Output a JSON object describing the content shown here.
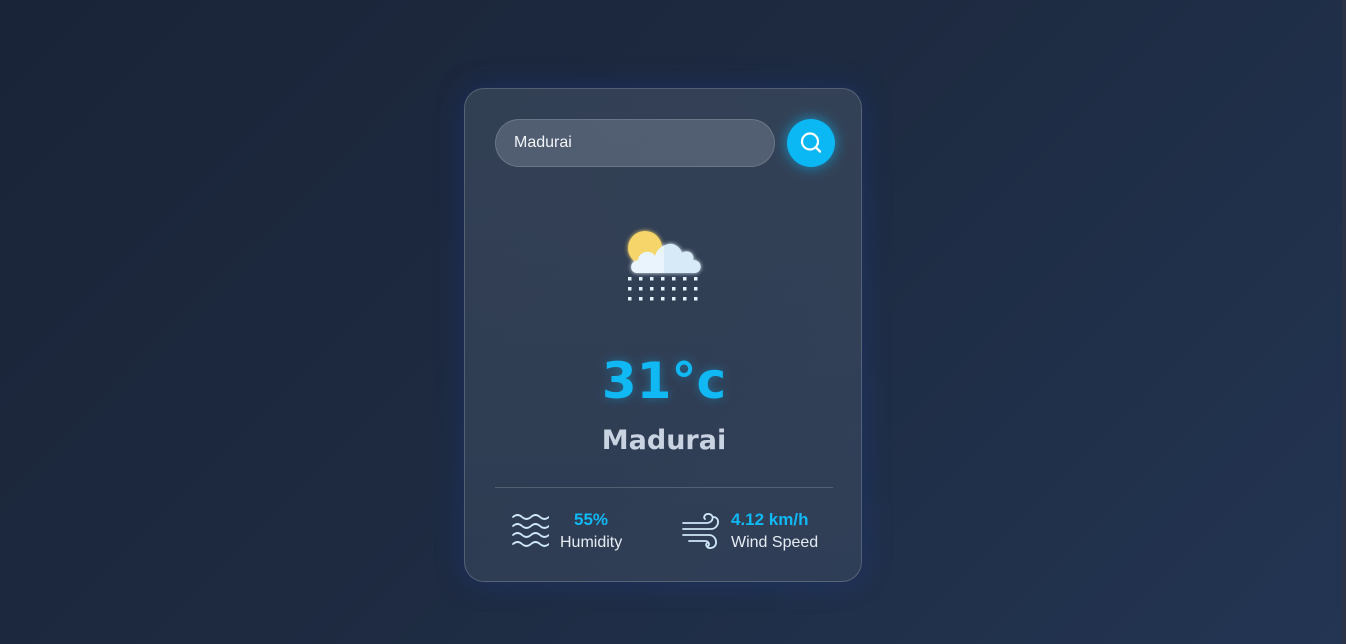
{
  "search": {
    "value": "Madurai",
    "placeholder": ""
  },
  "weather": {
    "condition_icon": "partly-cloudy-snow-icon",
    "temperature": "31°c",
    "city": "Madurai"
  },
  "details": {
    "humidity": {
      "icon": "humidity-waves-icon",
      "value": "55%",
      "label": "Humidity"
    },
    "wind": {
      "icon": "wind-icon",
      "value": "4.12 km/h",
      "label": "Wind Speed"
    }
  },
  "colors": {
    "accent": "#0bb8f4",
    "background": "#1d2a40",
    "text_muted": "#c9d3e2"
  }
}
